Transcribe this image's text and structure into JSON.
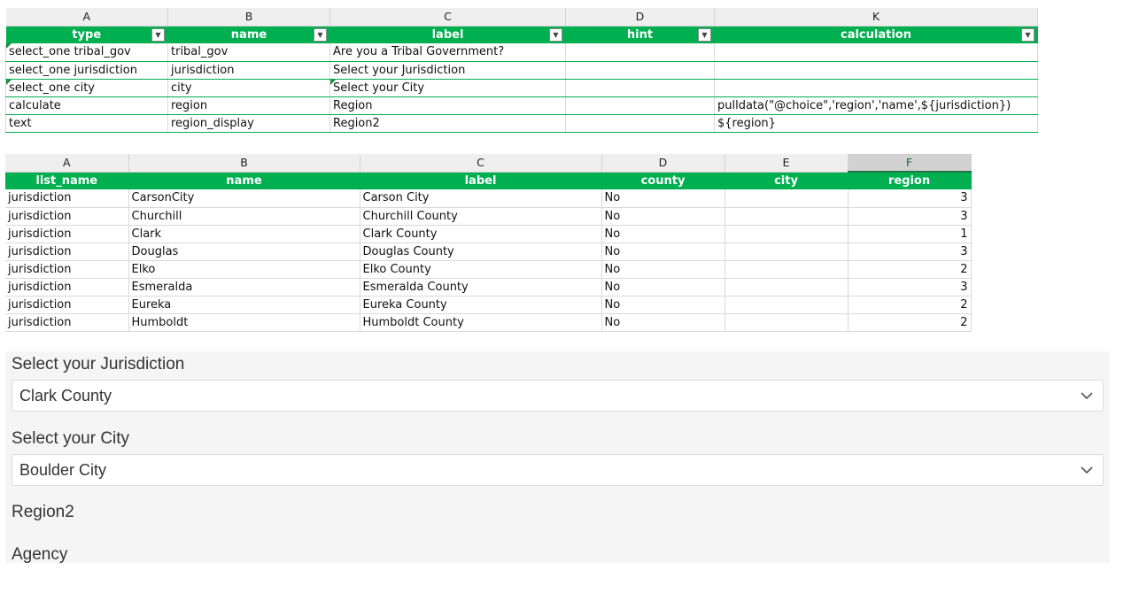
{
  "survey_sheet": {
    "col_letters": [
      "A",
      "B",
      "C",
      "D",
      "K"
    ],
    "headers": [
      "type",
      "name",
      "label",
      "hint",
      "calculation"
    ],
    "rows": [
      [
        "select_one tribal_gov",
        "tribal_gov",
        "Are you a Tribal Government?",
        "",
        ""
      ],
      [
        "select_one jurisdiction",
        "jurisdiction",
        "Select your Jurisdiction",
        "",
        ""
      ],
      [
        "select_one city",
        "city",
        "Select your City",
        "",
        ""
      ],
      [
        "calculate",
        "region",
        "Region",
        "",
        "pulldata(\"@choice\",'region','name',${jurisdiction})"
      ],
      [
        "text",
        "region_display",
        "Region2",
        "",
        "${region}"
      ]
    ]
  },
  "choices_sheet": {
    "col_letters": [
      "A",
      "B",
      "C",
      "D",
      "E",
      "F"
    ],
    "headers": [
      "list_name",
      "name",
      "label",
      "county",
      "city",
      "region"
    ],
    "rows": [
      [
        "jurisdiction",
        "CarsonCity",
        "Carson City",
        "No",
        "",
        "3"
      ],
      [
        "jurisdiction",
        "Churchill",
        "Churchill County",
        "No",
        "",
        "3"
      ],
      [
        "jurisdiction",
        "Clark",
        "Clark County",
        "No",
        "",
        "1"
      ],
      [
        "jurisdiction",
        "Douglas",
        "Douglas County",
        "No",
        "",
        "3"
      ],
      [
        "jurisdiction",
        "Elko",
        "Elko County",
        "No",
        "",
        "2"
      ],
      [
        "jurisdiction",
        "Esmeralda",
        "Esmeralda County",
        "No",
        "",
        "3"
      ],
      [
        "jurisdiction",
        "Eureka",
        "Eureka County",
        "No",
        "",
        "2"
      ],
      [
        "jurisdiction",
        "Humboldt",
        "Humboldt County",
        "No",
        "",
        "2"
      ]
    ]
  },
  "form": {
    "jurisdiction_label": "Select your Jurisdiction",
    "jurisdiction_value": "Clark County",
    "city_label": "Select your City",
    "city_value": "Boulder City",
    "region2_label": "Region2",
    "agency_label": "Agency"
  },
  "icons": {
    "dropdown": "chevron-down-icon",
    "filter": "filter-dropdown-icon"
  },
  "colors": {
    "header_green": "#00b050",
    "form_background": "#f4f5f4"
  }
}
